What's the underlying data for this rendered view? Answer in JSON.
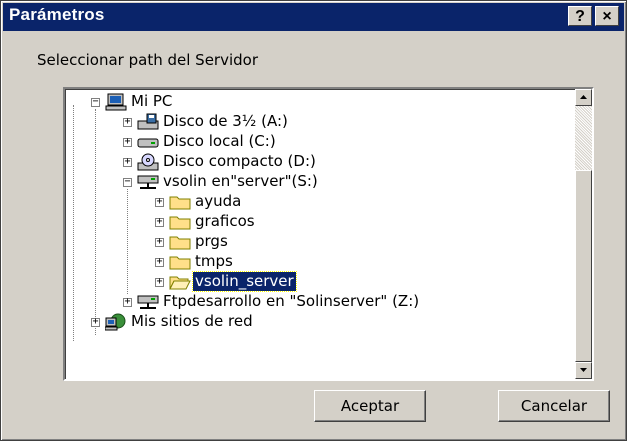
{
  "window": {
    "title": "Parámetros",
    "help_label": "?",
    "close_label": "×"
  },
  "prompt": "Seleccionar path del Servidor",
  "tree": {
    "items": [
      {
        "label": "Mi PC",
        "icon": "computer-icon",
        "expander": "−"
      },
      {
        "label": "Disco de 3½ (A:)",
        "icon": "floppy-drive-icon",
        "expander": "+"
      },
      {
        "label": "Disco local (C:)",
        "icon": "hard-drive-icon",
        "expander": "+"
      },
      {
        "label": "Disco compacto (D:)",
        "icon": "cd-drive-icon",
        "expander": "+"
      },
      {
        "label": "vsolin en\"server\"(S:)",
        "icon": "network-drive-icon",
        "expander": "−"
      },
      {
        "label": "ayuda",
        "icon": "folder-icon",
        "expander": "+"
      },
      {
        "label": "graficos",
        "icon": "folder-icon",
        "expander": "+"
      },
      {
        "label": "prgs",
        "icon": "folder-icon",
        "expander": "+"
      },
      {
        "label": "tmps",
        "icon": "folder-icon",
        "expander": "+"
      },
      {
        "label": "vsolin_server",
        "icon": "open-folder-icon",
        "expander": "+",
        "selected": true
      },
      {
        "label": "Ftpdesarrollo en \"Solinserver\" (Z:)",
        "icon": "network-drive-icon",
        "expander": "+"
      },
      {
        "label": "Mis sitios de red",
        "icon": "network-places-icon",
        "expander": "+"
      }
    ]
  },
  "buttons": {
    "ok": "Aceptar",
    "cancel": "Cancelar"
  },
  "colors": {
    "titlebar": "#0a246a",
    "face": "#d4d0c8",
    "selection": "#0a246a",
    "folder": "#ffe08a"
  }
}
